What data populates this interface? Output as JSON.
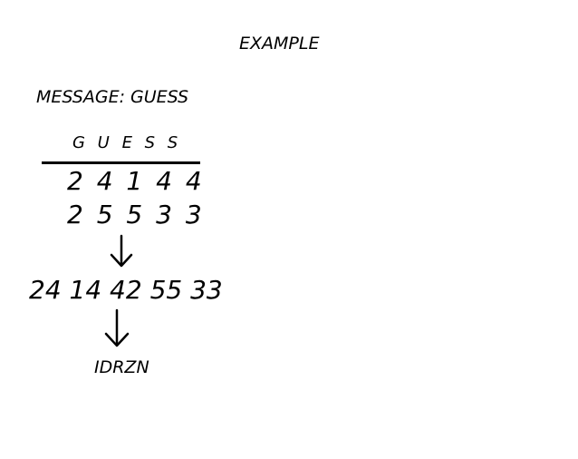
{
  "title": "EXAMPLE",
  "message_line": "MESSAGE: GUESS",
  "word_letters": "G U E S S",
  "row_one": "2 4 1 4 4",
  "row_two": "2 5 5 3 3",
  "pairs": "24 14 42 55 33",
  "ciphertext": "IDRZN",
  "icons": {
    "arrow_one": "down-arrow",
    "arrow_two": "down-arrow"
  }
}
